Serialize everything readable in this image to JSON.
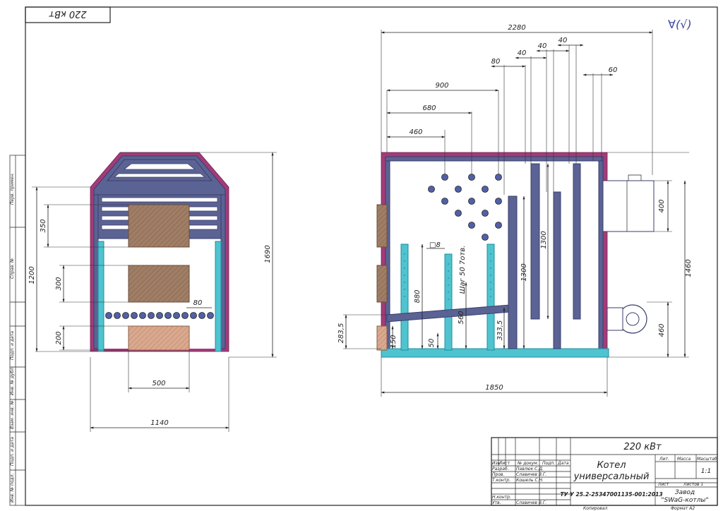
{
  "stamp_top": "220 кВт",
  "roughness_symbol": "∀(√)",
  "side_labels": [
    "Перв. примен.",
    "Справ. №",
    "Подп. и дата",
    "Инв. № дубл.",
    "Взам. инв. №",
    "Подп. и дата",
    "Инв. № подл."
  ],
  "front_view": {
    "dims": {
      "width_total": "1140",
      "height_total": "1690",
      "height_1200": "1200",
      "d350": "350",
      "d300": "300",
      "d200": "200",
      "d500": "500",
      "d80": "80"
    }
  },
  "side_view": {
    "dims": {
      "d2280": "2280",
      "d1850": "1850",
      "d900": "900",
      "d680": "680",
      "d460": "460",
      "d80": "80",
      "d40a": "40",
      "d40b": "40",
      "d40c": "40",
      "d60": "60",
      "d1460": "1460",
      "d400": "400",
      "d460r": "460",
      "d1300a": "1300",
      "d1300b": "1300",
      "d880": "880",
      "d560": "560",
      "d333": "333,5",
      "d283": "283,5",
      "d150": "150",
      "d50": "50",
      "d8": "□8",
      "step": "Шаг 50 7отв."
    }
  },
  "title_block": {
    "power": "220 кВт",
    "name_line1": "Котел",
    "name_line2": "универсальный",
    "code": "ТУ У 25.2-25347001135-001:2013",
    "lit": "Лит.",
    "mass": "Масса",
    "scale_h": "Масштаб",
    "scale": "1:1",
    "sheet": "Лист",
    "sheets": "Листов  1",
    "org_line1": "Завод",
    "org_line2": "\"SWaG-котлы\"",
    "copied": "Копировал",
    "format": "Формат  А2",
    "hdr": [
      "Изм",
      "Лист",
      "№ докум.",
      "Подп.",
      "Дата"
    ],
    "rows": [
      {
        "role": "Разраб.",
        "name": "Павлюк С.Д."
      },
      {
        "role": "Пров.",
        "name": "Славичев В.Г."
      },
      {
        "role": "Т.контр.",
        "name": "Кошель С.Н."
      },
      {
        "role": "Н.контр.",
        "name": ""
      },
      {
        "role": "Утв.",
        "name": "Славичев В.Г."
      }
    ]
  }
}
